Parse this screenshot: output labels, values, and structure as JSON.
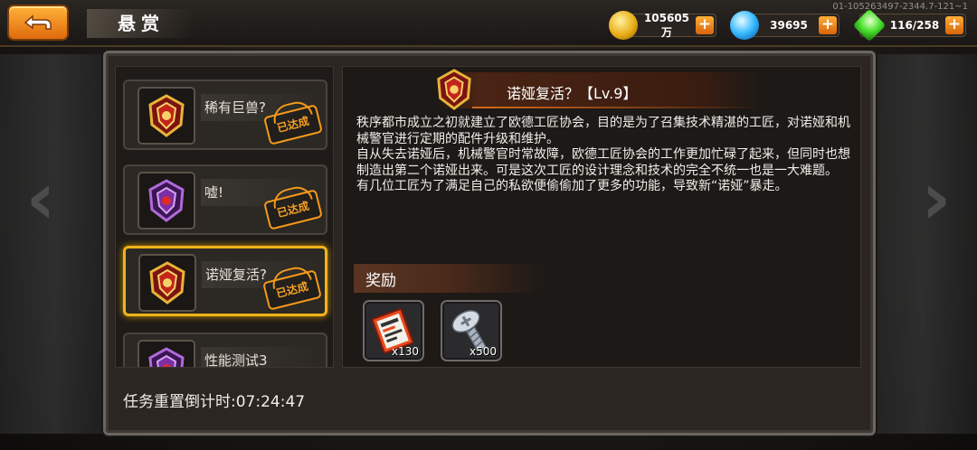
{
  "build_id": "01-105263497-2344.7-121~1",
  "header": {
    "title": "悬赏"
  },
  "currencies": {
    "gold": {
      "value": "105605万",
      "icon": "gold-coin-icon"
    },
    "gem": {
      "value": "39695",
      "icon": "blue-gem-icon"
    },
    "energy": {
      "value": "116/258",
      "icon": "green-crystal-icon"
    }
  },
  "quests": [
    {
      "name": "稀有巨兽?",
      "status": "已达成",
      "emblem": "red-gold-emblem"
    },
    {
      "name": "嘘!",
      "status": "已达成",
      "emblem": "purple-emblem"
    },
    {
      "name": "诺娅复活?",
      "status": "已达成",
      "emblem": "red-gold-emblem",
      "selected": true
    },
    {
      "name": "性能测试3",
      "status": "",
      "emblem": "purple-emblem"
    }
  ],
  "detail": {
    "title": "诺娅复活？【Lv.9】",
    "paragraphs": [
      "秩序都市成立之初就建立了欧德工匠协会，目的是为了召集技术精湛的工匠，对诺娅和机械警官进行定期的配件升级和维护。",
      "自从失去诺娅后，机械警官时常故障，欧德工匠协会的工作更加忙碌了起来，但同时也想制造出第二个诺娅出来。可是这次工匠的设计理念和技术的完全不统一也是一大难题。",
      "有几位工匠为了满足自己的私欲便偷偷加了更多的功能，导致新“诺娅”暴走。"
    ]
  },
  "rewards": {
    "label": "奖励",
    "items": [
      {
        "icon": "ticket-scroll-icon",
        "qty": "x130"
      },
      {
        "icon": "screw-bolt-icon",
        "qty": "x500"
      }
    ]
  },
  "footer": {
    "countdown": "任务重置倒计时:07:24:47"
  },
  "colors": {
    "accent": "#f0b419",
    "stamp": "#f39a1a",
    "button": "#e06a0c"
  }
}
